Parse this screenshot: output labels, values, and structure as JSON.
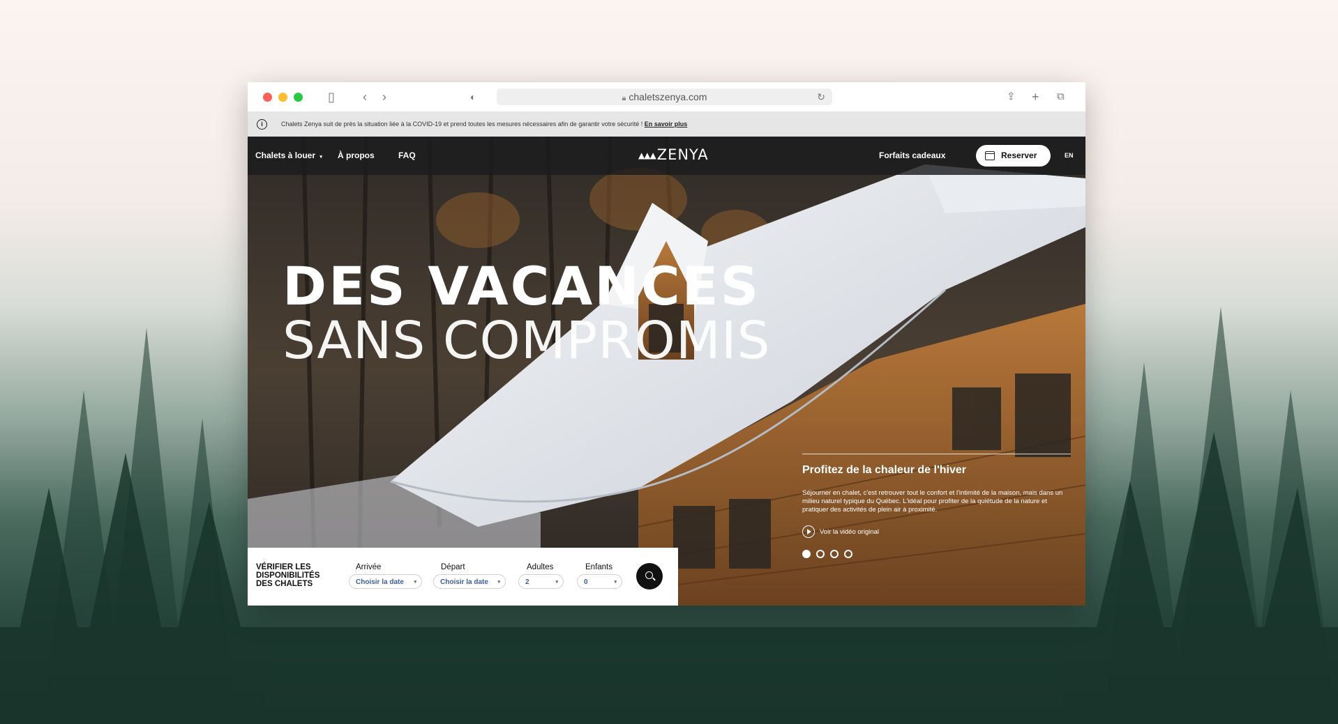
{
  "browser": {
    "url": "chaletszenya.com"
  },
  "banner": {
    "text": "Chalets Zenya suit de près la situation liée à la COVID-19 et prend toutes les mesures nécessaires afin de garantir votre sécurité ! ",
    "link": "En savoir plus"
  },
  "nav": {
    "chalets": "Chalets à louer",
    "chalets_caret": "▾",
    "about": "À propos",
    "faq": "FAQ",
    "logo": "ZENYA",
    "logo_trees": "▲▲▲",
    "gifts": "Forfaits cadeaux",
    "reserve": "Reserver",
    "lang": "EN"
  },
  "hero": {
    "headline_bold": "DES VACANCES",
    "headline_light": "SANS COMPROMIS",
    "slide_title": "Profitez de la chaleur de l'hiver",
    "slide_desc": "Séjourner en chalet, c'est retrouver tout le confort et l'intimité de la maison, mais dans un milieu naturel typique du Québec. L'idéal pour profiter de la quiétude de la nature et pratiquer des activités de plein air à proximité.",
    "video_link": "Voir la vidéo original",
    "slides_total": 4,
    "slide_active": 1
  },
  "booking": {
    "title": "Vérifier les disponibilités des chalets",
    "arrival_label": "Arrivée",
    "arrival_value": "Choisir la date",
    "departure_label": "Départ",
    "departure_value": "Choisir la date",
    "adults_label": "Adultes",
    "adults_value": "2",
    "children_label": "Enfants",
    "children_value": "0",
    "caret": "▾"
  },
  "colors": {
    "accent_link": "#3a5fa0",
    "nav_bg": "#1c1c1e"
  },
  "icons": [
    "sidebar-icon",
    "back-icon",
    "forward-icon",
    "shield-icon",
    "lock-icon",
    "reload-icon",
    "share-icon",
    "new-tab-icon",
    "tabs-icon",
    "info-icon",
    "calendar-icon",
    "play-icon",
    "search-icon"
  ]
}
